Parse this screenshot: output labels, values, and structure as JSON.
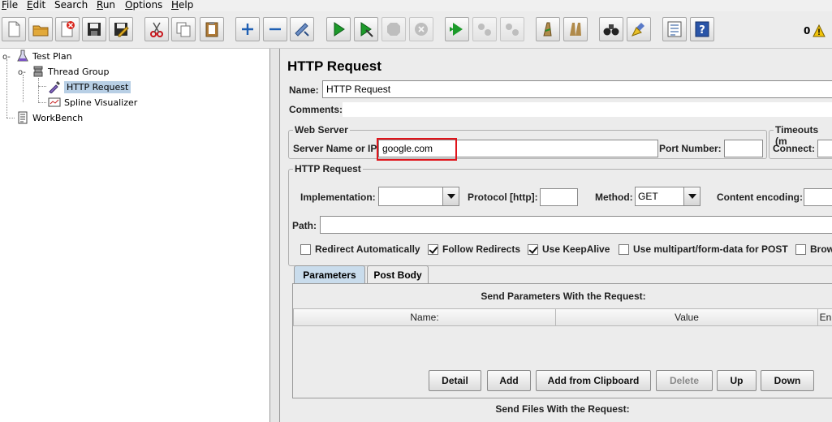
{
  "menubar": {
    "items": [
      {
        "mnemonic": "F",
        "rest": "ile"
      },
      {
        "mnemonic": "E",
        "rest": "dit"
      },
      {
        "mnemonic": "",
        "rest": "Search"
      },
      {
        "mnemonic": "R",
        "rest": "un"
      },
      {
        "mnemonic": "O",
        "rest": "ptions"
      },
      {
        "mnemonic": "H",
        "rest": "elp"
      }
    ]
  },
  "toolbar": {
    "error_count": "0",
    "buttons": [
      "new-icon",
      "open-icon",
      "close-icon",
      "save-icon",
      "save-as-icon",
      "cut-icon",
      "copy-icon",
      "paste-icon",
      "expand-icon",
      "collapse-icon",
      "toggle-icon",
      "start-icon",
      "start-no-timers-icon",
      "stop-icon",
      "shutdown-icon",
      "remote-start-icon",
      "remote-stop-icon",
      "remote-exit-icon",
      "clear-icon",
      "clear-all-icon",
      "search-icon",
      "reset-search-icon",
      "function-helper-icon",
      "help-icon"
    ]
  },
  "tree": {
    "test_plan": "Test Plan",
    "thread_group": "Thread Group",
    "http_request": "HTTP Request",
    "spline_visualizer": "Spline Visualizer",
    "workbench": "WorkBench"
  },
  "main": {
    "title": "HTTP Request",
    "name_label": "Name:",
    "name_value": "HTTP Request",
    "comments_label": "Comments:",
    "web_server": {
      "title": "Web Server",
      "server_label": "Server Name or IP:",
      "server_value": "google.com",
      "port_label": "Port Number:",
      "port_value": ""
    },
    "timeouts": {
      "title": "Timeouts (m",
      "connect_label": "Connect:"
    },
    "http_request": {
      "title": "HTTP Request",
      "implementation_label": "Implementation:",
      "implementation_value": "",
      "protocol_label": "Protocol [http]:",
      "protocol_value": "",
      "method_label": "Method:",
      "method_value": "GET",
      "encoding_label": "Content encoding:",
      "path_label": "Path:",
      "path_value": ""
    },
    "options": [
      {
        "label": "Redirect Automatically",
        "checked": false
      },
      {
        "label": "Follow Redirects",
        "checked": true
      },
      {
        "label": "Use KeepAlive",
        "checked": true
      },
      {
        "label": "Use multipart/form-data for POST",
        "checked": false
      },
      {
        "label": "Brow",
        "checked": false
      }
    ],
    "tabs": [
      "Parameters",
      "Post Body"
    ],
    "params": {
      "heading": "Send Parameters With the Request:",
      "columns": [
        "Name:",
        "Value",
        "En"
      ],
      "buttons": [
        "Detail",
        "Add",
        "Add from Clipboard",
        "Delete",
        "Up",
        "Down"
      ]
    },
    "files_heading": "Send Files With the Request:"
  },
  "colors": {
    "accent_selection": "#b8cfe5",
    "active_tab": "#c9dcec",
    "highlight_box": "#e0141b"
  }
}
